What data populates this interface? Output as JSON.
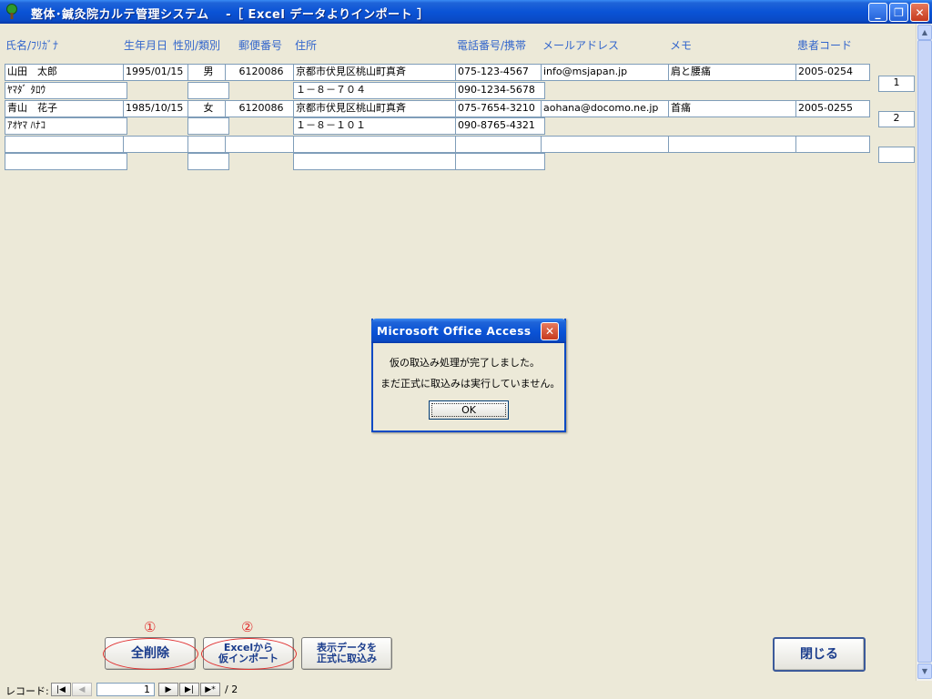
{
  "window": {
    "title": "整体･鍼灸院カルテ管理システム　 -［ Excel データよりインポート ］",
    "minimize": "_",
    "restore": "❐",
    "close": "✕"
  },
  "headers": {
    "name": "氏名/ﾌﾘｶﾞﾅ",
    "birth": "生年月日",
    "gender": "性別/類別",
    "zip": "郵便番号",
    "address": "住所",
    "phone": "電話番号/携帯",
    "email": "メールアドレス",
    "memo": "メモ",
    "code": "患者コード"
  },
  "records": [
    {
      "name": "山田　太郎",
      "kana": "ﾔﾏﾀﾞ ﾀﾛｳ",
      "birth": "1995/01/15",
      "gender": "男",
      "type": "",
      "zip": "6120086",
      "address": "京都市伏見区桃山町真斉",
      "address2": "１－８－７０４",
      "phone": "075-123-4567",
      "mobile": "090-1234-5678",
      "email": "info@msjapan.jp",
      "memo": "肩と腰痛",
      "code": "2005-0254",
      "recno": "1"
    },
    {
      "name": "青山　花子",
      "kana": "ｱｵﾔﾏ ﾊﾅｺ",
      "birth": "1985/10/15",
      "gender": "女",
      "type": "",
      "zip": "6120086",
      "address": "京都市伏見区桃山町真斉",
      "address2": "１－８－１０１",
      "phone": "075-7654-3210",
      "mobile": "090-8765-4321",
      "email": "aohana@docomo.ne.jp",
      "memo": "首痛",
      "code": "2005-0255",
      "recno": "2"
    }
  ],
  "buttons": {
    "delete_all": "全削除",
    "delete_all_marker": "①",
    "import_temp_line1": "Excelから",
    "import_temp_line2": "仮インポート",
    "import_temp_marker": "②",
    "import_final_line1": "表示データを",
    "import_final_line2": "正式に取込み",
    "close": "閉じる"
  },
  "record_nav": {
    "label": "レコード:",
    "current": "1",
    "total": "/ 2"
  },
  "dialog": {
    "title": "Microsoft Office Access",
    "message1": "仮の取込み処理が完了しました。",
    "message2": "まだ正式に取込みは実行していません。",
    "ok": "OK",
    "close": "✕"
  },
  "colors": {
    "header_text": "#3366cc",
    "title_bar": "#0a53d6",
    "marker": "#e03030"
  }
}
